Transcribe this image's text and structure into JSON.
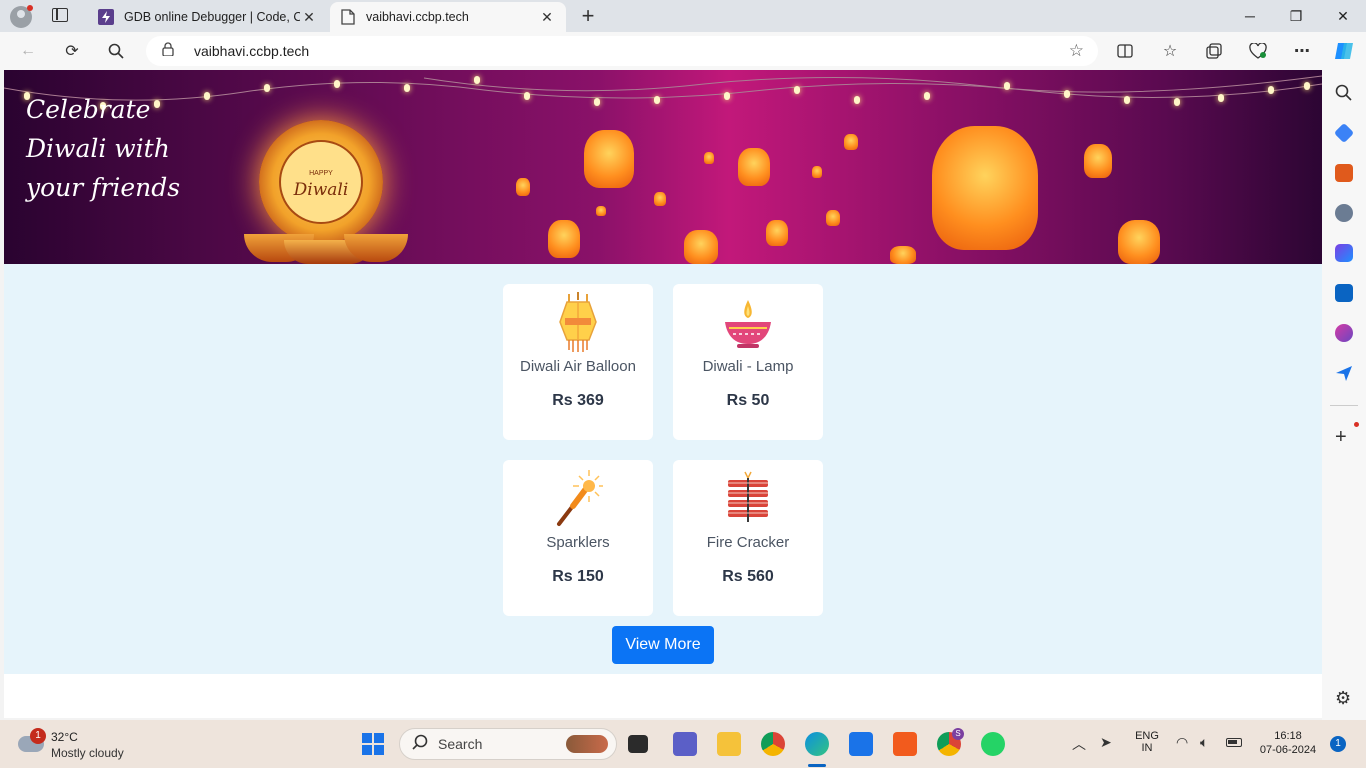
{
  "browser": {
    "tabs": [
      {
        "title": "GDB online Debugger | Code, Co",
        "active": false
      },
      {
        "title": "vaibhavi.ccbp.tech",
        "active": true
      }
    ],
    "address": "vaibhavi.ccbp.tech"
  },
  "banner": {
    "line1": "Celebrate",
    "line2": "Diwali with",
    "line3": "your friends",
    "diya_line1": "HAPPY",
    "diya_line2": "Diwali"
  },
  "products": [
    {
      "name": "Diwali Air Balloon",
      "price": "Rs 369",
      "icon": "lantern-icon"
    },
    {
      "name": "Diwali - Lamp",
      "price": "Rs 50",
      "icon": "diya-icon"
    },
    {
      "name": "Sparklers",
      "price": "Rs 150",
      "icon": "sparkler-icon"
    },
    {
      "name": "Fire Cracker",
      "price": "Rs 560",
      "icon": "firecracker-icon"
    }
  ],
  "view_more_label": "View More",
  "taskbar": {
    "weather_temp": "32°C",
    "weather_desc": "Mostly cloudy",
    "weather_badge": "1",
    "search_label": "Search",
    "lang_line1": "ENG",
    "lang_line2": "IN",
    "time": "16:18",
    "date": "07-06-2024",
    "notification_count": "1",
    "chrome_badge": "S"
  },
  "colors": {
    "accent": "#0b74f5",
    "page_bg": "#e6f4fb",
    "banner": "#8a1169"
  }
}
